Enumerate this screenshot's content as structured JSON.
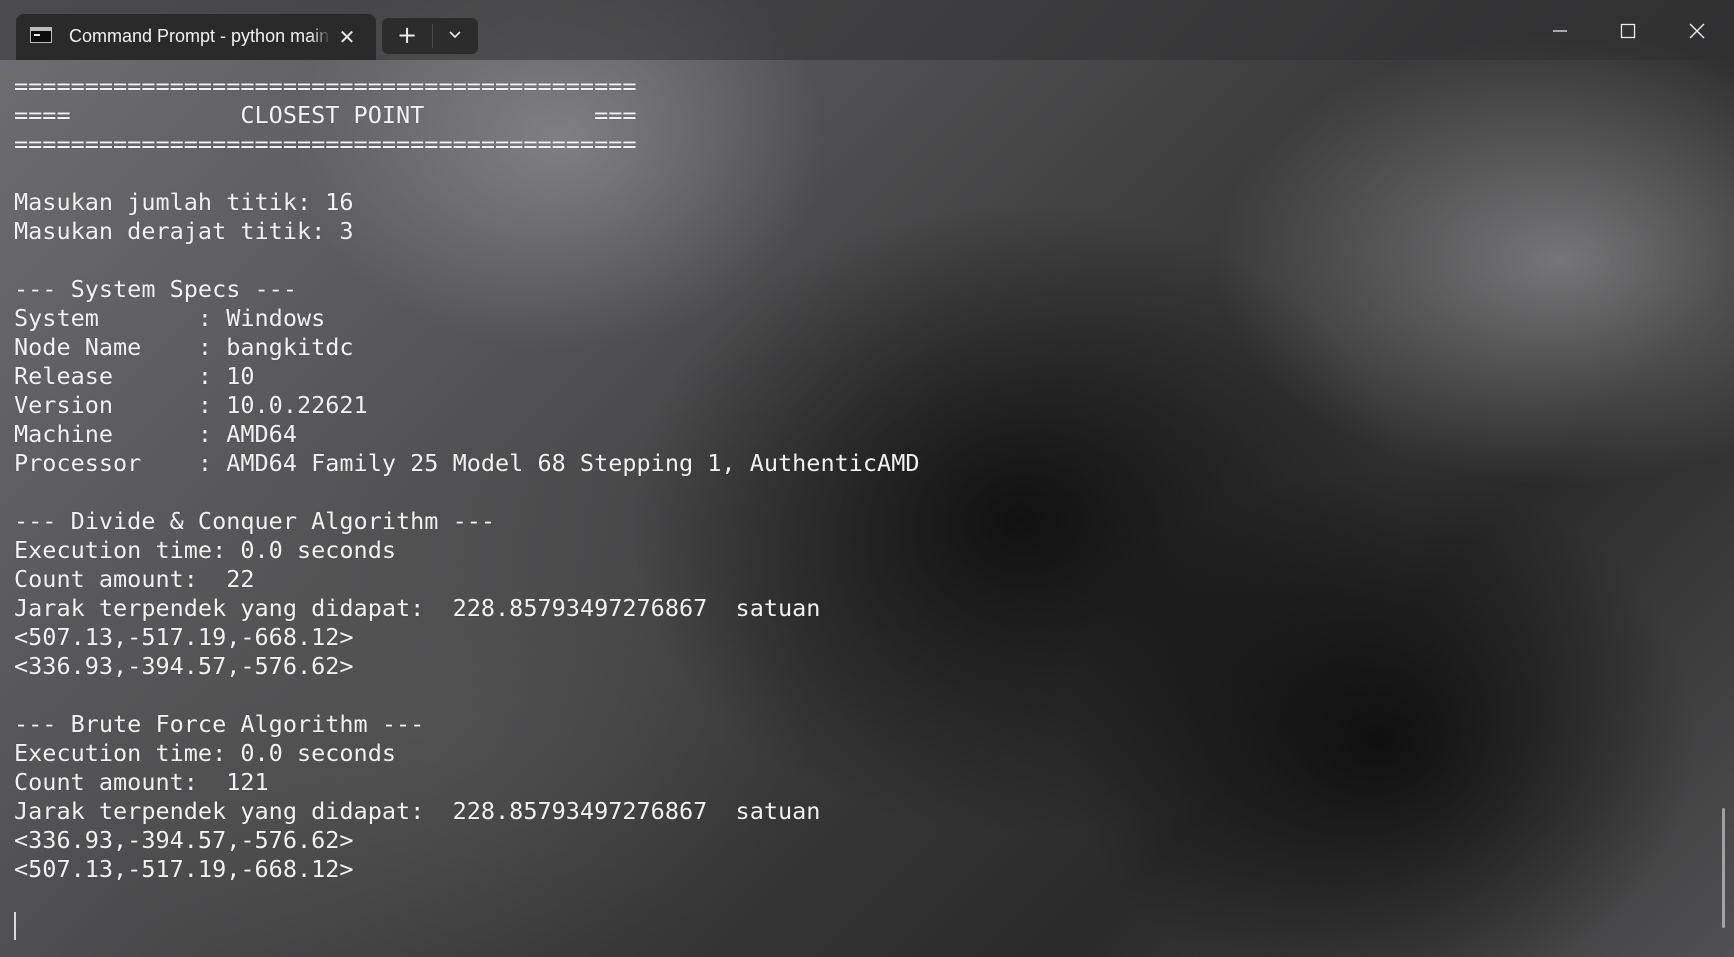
{
  "window": {
    "tab_title": "Command Prompt - python main.py",
    "tab_close_glyph": "✕",
    "new_tab_glyph": "+",
    "tab_icon": "terminal-icon",
    "controls": {
      "minimize_icon": "minimize-icon",
      "maximize_icon": "maximize-icon",
      "close_icon": "close-icon"
    }
  },
  "terminal": {
    "lines": [
      "============================================",
      "====            CLOSEST POINT            ===",
      "============================================",
      "",
      "Masukan jumlah titik: 16",
      "Masukan derajat titik: 3",
      "",
      "--- System Specs ---",
      "System       : Windows",
      "Node Name    : bangkitdc",
      "Release      : 10",
      "Version      : 10.0.22621",
      "Machine      : AMD64",
      "Processor    : AMD64 Family 25 Model 68 Stepping 1, AuthenticAMD",
      "",
      "--- Divide & Conquer Algorithm ---",
      "Execution time: 0.0 seconds",
      "Count amount:  22",
      "Jarak terpendek yang didapat:  228.85793497276867  satuan",
      "<507.13,-517.19,-668.12>",
      "<336.93,-394.57,-576.62>",
      "",
      "--- Brute Force Algorithm ---",
      "Execution time: 0.0 seconds",
      "Count amount:  121",
      "Jarak terpendek yang didapat:  228.85793497276867  satuan",
      "<336.93,-394.57,-576.62>",
      "<507.13,-517.19,-668.12>"
    ]
  }
}
